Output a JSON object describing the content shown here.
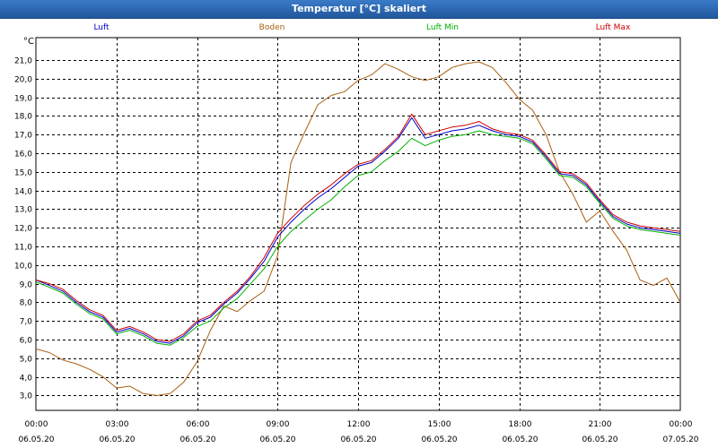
{
  "window": {
    "title": "Temperatur [°C] skaliert"
  },
  "chart_data": {
    "type": "line",
    "title": "Temperatur [°C] skaliert",
    "ylabel": "°C",
    "xlabel": "",
    "ylim": [
      2.2,
      22.2
    ],
    "xlim": [
      0,
      24
    ],
    "grid": true,
    "legend_position": "top",
    "y_ticks": [
      "3,0",
      "4,0",
      "5,0",
      "6,0",
      "7,0",
      "8,0",
      "9,0",
      "10,0",
      "11,0",
      "12,0",
      "13,0",
      "14,0",
      "15,0",
      "16,0",
      "17,0",
      "18,0",
      "19,0",
      "20,0",
      "21,0"
    ],
    "y_tick_values": [
      3,
      4,
      5,
      6,
      7,
      8,
      9,
      10,
      11,
      12,
      13,
      14,
      15,
      16,
      17,
      18,
      19,
      20,
      21
    ],
    "x_ticks": [
      {
        "x": 0,
        "time": "00:00",
        "date": "06.05.20"
      },
      {
        "x": 3,
        "time": "03:00",
        "date": "06.05.20"
      },
      {
        "x": 6,
        "time": "06:00",
        "date": "06.05.20"
      },
      {
        "x": 9,
        "time": "09:00",
        "date": "06.05.20"
      },
      {
        "x": 12,
        "time": "12:00",
        "date": "06.05.20"
      },
      {
        "x": 15,
        "time": "15:00",
        "date": "06.05.20"
      },
      {
        "x": 18,
        "time": "18:00",
        "date": "06.05.20"
      },
      {
        "x": 21,
        "time": "21:00",
        "date": "06.05.20"
      },
      {
        "x": 24,
        "time": "00:00",
        "date": "07.05.20"
      }
    ],
    "series": [
      {
        "name": "Luft",
        "color": "#0000cc",
        "x": [
          0,
          0.5,
          1,
          1.5,
          2,
          2.5,
          3,
          3.5,
          4,
          4.5,
          5,
          5.5,
          6,
          6.5,
          7,
          7.5,
          8,
          8.5,
          9,
          9.5,
          10,
          10.5,
          11,
          11.5,
          12,
          12.5,
          13,
          13.5,
          14,
          14.5,
          15,
          15.5,
          16,
          16.5,
          17,
          17.5,
          18,
          18.5,
          19,
          19.5,
          20,
          20.5,
          21,
          21.5,
          22,
          22.5,
          23,
          23.5,
          24
        ],
        "values": [
          9.2,
          8.9,
          8.6,
          8.0,
          7.5,
          7.2,
          6.4,
          6.6,
          6.3,
          5.9,
          5.8,
          6.2,
          6.9,
          7.2,
          7.9,
          8.5,
          9.3,
          10.2,
          11.5,
          12.3,
          13.0,
          13.6,
          14.1,
          14.7,
          15.3,
          15.5,
          16.1,
          16.8,
          17.9,
          16.8,
          17.0,
          17.2,
          17.3,
          17.5,
          17.2,
          17.0,
          16.9,
          16.6,
          15.8,
          14.9,
          14.8,
          14.3,
          13.4,
          12.6,
          12.2,
          12.0,
          11.9,
          11.8,
          11.7
        ]
      },
      {
        "name": "Boden",
        "color": "#a86010",
        "x": [
          0,
          0.5,
          1,
          1.5,
          2,
          2.5,
          3,
          3.5,
          4,
          4.5,
          5,
          5.5,
          6,
          6.5,
          7,
          7.5,
          8,
          8.5,
          9,
          9.5,
          10,
          10.5,
          11,
          11.5,
          12,
          12.5,
          13,
          13.5,
          14,
          14.5,
          15,
          15.5,
          16,
          16.5,
          17,
          17.5,
          18,
          18.5,
          19,
          19.5,
          20,
          20.5,
          21,
          21.5,
          22,
          22.5,
          23,
          23.5,
          24
        ],
        "values": [
          5.5,
          5.3,
          4.9,
          4.7,
          4.4,
          4.0,
          3.4,
          3.5,
          3.1,
          3.0,
          3.1,
          3.7,
          4.8,
          6.5,
          7.8,
          7.5,
          8.1,
          8.6,
          10.5,
          15.5,
          17.1,
          18.6,
          19.1,
          19.3,
          19.9,
          20.2,
          20.8,
          20.5,
          20.1,
          19.9,
          20.1,
          20.6,
          20.8,
          20.9,
          20.6,
          19.8,
          18.9,
          18.3,
          17.0,
          15.0,
          13.8,
          12.3,
          12.9,
          11.8,
          10.8,
          9.2,
          8.9,
          9.3,
          8.0
        ]
      },
      {
        "name": "Luft Min",
        "color": "#00b000",
        "x": [
          0,
          0.5,
          1,
          1.5,
          2,
          2.5,
          3,
          3.5,
          4,
          4.5,
          5,
          5.5,
          6,
          6.5,
          7,
          7.5,
          8,
          8.5,
          9,
          9.5,
          10,
          10.5,
          11,
          11.5,
          12,
          12.5,
          13,
          13.5,
          14,
          14.5,
          15,
          15.5,
          16,
          16.5,
          17,
          17.5,
          18,
          18.5,
          19,
          19.5,
          20,
          20.5,
          21,
          21.5,
          22,
          22.5,
          23,
          23.5,
          24
        ],
        "values": [
          9.1,
          8.8,
          8.5,
          7.9,
          7.4,
          7.1,
          6.3,
          6.5,
          6.2,
          5.8,
          5.7,
          6.1,
          6.7,
          7.0,
          7.7,
          8.2,
          9.0,
          9.8,
          11.0,
          11.8,
          12.4,
          13.0,
          13.5,
          14.2,
          14.8,
          15.0,
          15.6,
          16.1,
          16.8,
          16.4,
          16.7,
          16.9,
          17.0,
          17.2,
          17.0,
          16.9,
          16.8,
          16.5,
          15.7,
          14.8,
          14.7,
          14.2,
          13.3,
          12.5,
          12.1,
          11.9,
          11.8,
          11.7,
          11.6
        ]
      },
      {
        "name": "Luft Max",
        "color": "#cc0000",
        "x": [
          0,
          0.5,
          1,
          1.5,
          2,
          2.5,
          3,
          3.5,
          4,
          4.5,
          5,
          5.5,
          6,
          6.5,
          7,
          7.5,
          8,
          8.5,
          9,
          9.5,
          10,
          10.5,
          11,
          11.5,
          12,
          12.5,
          13,
          13.5,
          14,
          14.5,
          15,
          15.5,
          16,
          16.5,
          17,
          17.5,
          18,
          18.5,
          19,
          19.5,
          20,
          20.5,
          21,
          21.5,
          22,
          22.5,
          23,
          23.5,
          24
        ],
        "values": [
          9.2,
          9.0,
          8.7,
          8.1,
          7.6,
          7.3,
          6.5,
          6.7,
          6.4,
          6.0,
          5.9,
          6.3,
          7.0,
          7.3,
          8.0,
          8.6,
          9.4,
          10.4,
          11.7,
          12.5,
          13.2,
          13.8,
          14.3,
          14.9,
          15.4,
          15.6,
          16.2,
          16.9,
          18.1,
          17.0,
          17.2,
          17.4,
          17.5,
          17.7,
          17.3,
          17.1,
          17.0,
          16.7,
          15.9,
          15.0,
          14.9,
          14.4,
          13.5,
          12.7,
          12.3,
          12.1,
          12.0,
          11.9,
          11.8
        ]
      }
    ]
  }
}
